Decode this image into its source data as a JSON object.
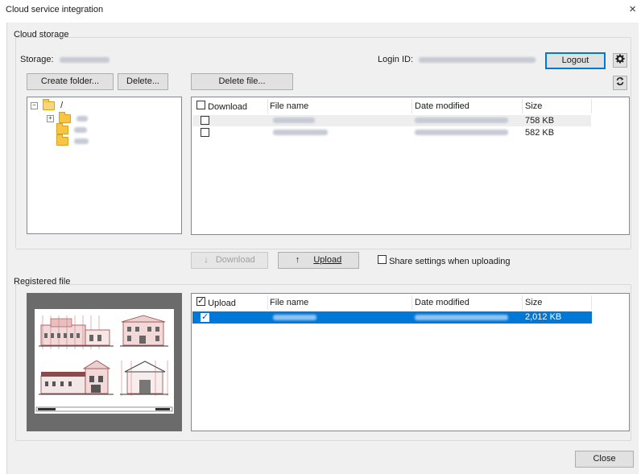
{
  "window": {
    "title": "Cloud service integration",
    "close_glyph": "×"
  },
  "cloud_storage": {
    "group_label": "Cloud storage",
    "storage_label": "Storage:",
    "login_label": "Login ID:",
    "logout_button": "Logout",
    "create_folder_button": "Create folder...",
    "delete_button": "Delete...",
    "delete_file_button": "Delete file...",
    "tree": {
      "root_label": "/"
    },
    "file_list": {
      "headers": [
        "Download",
        "File name",
        "Date modified",
        "Size"
      ],
      "rows": [
        {
          "download": false,
          "size": "758 KB"
        },
        {
          "download": false,
          "size": "582 KB"
        }
      ]
    }
  },
  "actions": {
    "download_button": "Download",
    "upload_button": "Upload",
    "share_settings_label": "Share settings when uploading",
    "share_settings_checked": false
  },
  "registered_file": {
    "group_label": "Registered file",
    "file_list": {
      "headers": [
        "Upload",
        "File name",
        "Date modified",
        "Size"
      ],
      "header_checked": true,
      "rows": [
        {
          "upload": true,
          "size": "2,012 KB",
          "selected": true
        }
      ]
    }
  },
  "footer": {
    "close_button": "Close"
  },
  "colors": {
    "selection": "#0078d7",
    "focus_border": "#0078d7",
    "dialog_bg": "#f0f0f0"
  },
  "icons": [
    "close-icon",
    "gear-icon",
    "refresh-icon",
    "folder-icon",
    "download-arrow-icon",
    "upload-arrow-icon"
  ]
}
